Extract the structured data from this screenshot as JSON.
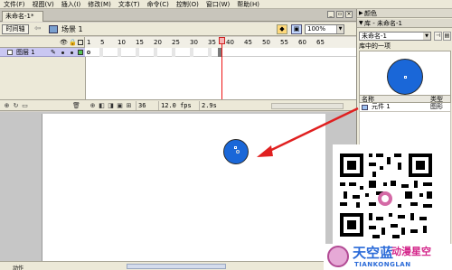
{
  "menubar": {
    "items": [
      "文件(F)",
      "视图(V)",
      "插入(I)",
      "修改(M)",
      "文本(T)",
      "命令(C)",
      "控制(O)",
      "窗口(W)",
      "帮助(H)"
    ]
  },
  "document": {
    "tab_label": "未命名-1*",
    "timeline_button": "时间轴",
    "scene_label": "场景 1",
    "zoom": "100%"
  },
  "timeline": {
    "frame_numbers": [
      "1",
      "5",
      "10",
      "15",
      "20",
      "25",
      "30",
      "35",
      "40",
      "45",
      "50",
      "55",
      "60",
      "65"
    ],
    "layer_name": "图层 1",
    "current_frame": "36",
    "fps": "12.0 fps",
    "time": "2.9s"
  },
  "panels": {
    "color_title": "颜色",
    "library_title": "库 - 未命名-1",
    "library_dropdown": "未命名-1",
    "library_count_label": "库中的一项",
    "col_name": "名称",
    "col_type": "类型",
    "item_name": "元件 1",
    "item_type": "图形"
  },
  "footer": {
    "actions_label": "动作"
  },
  "logo": {
    "main": "天空蓝",
    "sub": "动漫星空",
    "en": "TIANKONGLAN"
  },
  "colors": {
    "circle_fill": "#1a67d8",
    "arrow": "#e02020",
    "layer_highlight": "#c9c7f2"
  }
}
